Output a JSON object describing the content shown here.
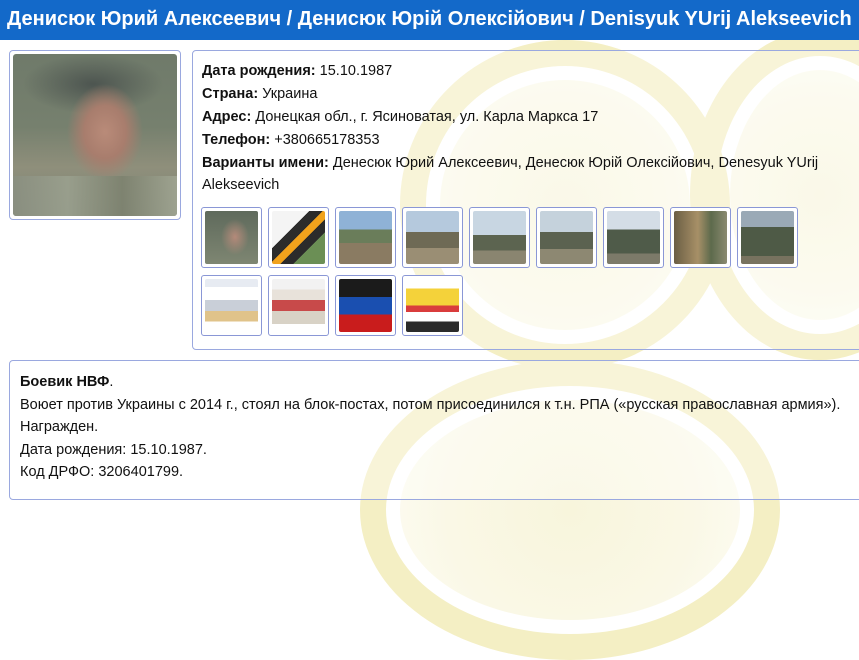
{
  "header": {
    "title": "Денисюк Юрий Алексеевич / Денисюк Юрій Олексійович / Denisyuk YUrij Alekseevich"
  },
  "profile": {
    "birth_label": "Дата рождения:",
    "birth_value": "15.10.1987",
    "country_label": "Страна:",
    "country_value": "Украина",
    "address_label": "Адрес:",
    "address_value": "Донецкая обл., г. Ясиноватая, ул. Карла Маркса 17",
    "phone_label": "Телефон:",
    "phone_value": "+380665178353",
    "names_label": "Варианты имени:",
    "names_value": "Денесюк Юрий Алексеевич, Денесюк Юрій Олексійович, Denesyuk YUrij Alekseevich"
  },
  "description": {
    "title": "Боевик НВФ",
    "title_suffix": ".",
    "line1": "Воюет против Украины с 2014 г., стоял на блок-постах, потом присоединился к т.н. РПА («русская православная армия»). Награжден.",
    "line2": "Дата рождения: 15.10.1987.",
    "line3": "Код ДРФО: 3206401799."
  },
  "colors": {
    "header_bg": "#1369c9",
    "border": "#9aa8df",
    "watermark": "#ece3a6"
  }
}
